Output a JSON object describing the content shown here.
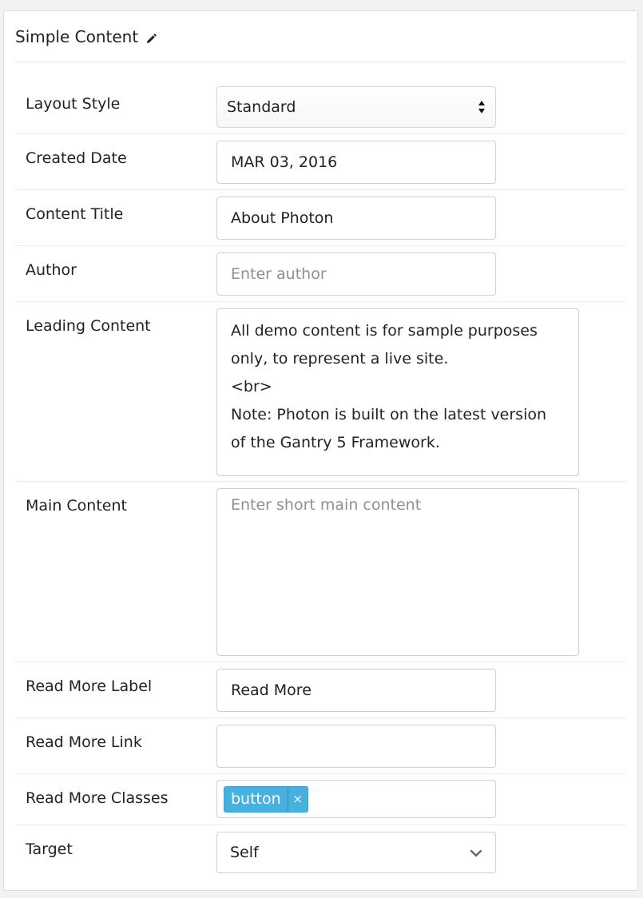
{
  "panel": {
    "title": "Simple Content",
    "title_icon": "pencil-icon"
  },
  "fields": {
    "layout_style": {
      "label": "Layout Style",
      "value": "Standard",
      "icon": "sort-updown-icon"
    },
    "created_date": {
      "label": "Created Date",
      "value": "MAR 03, 2016"
    },
    "content_title": {
      "label": "Content Title",
      "value": "About Photon"
    },
    "author": {
      "label": "Author",
      "value": "",
      "placeholder": "Enter author"
    },
    "leading_content": {
      "label": "Leading Content",
      "lines": [
        "All demo content is for sample purposes",
        "only, to represent a live site.",
        "<br>",
        "Note: Photon is built on the latest version",
        "of the Gantry 5 Framework."
      ]
    },
    "main_content": {
      "label": "Main Content",
      "value": "",
      "placeholder": "Enter short main content"
    },
    "read_more_label": {
      "label": "Read More Label",
      "value": "Read More"
    },
    "read_more_link": {
      "label": "Read More Link",
      "value": ""
    },
    "read_more_classes": {
      "label": "Read More Classes",
      "tags": [
        "button"
      ],
      "remove_glyph": "×"
    },
    "target": {
      "label": "Target",
      "value": "Self",
      "icon": "chevron-down-icon"
    }
  },
  "colors": {
    "tag_background": "#46b0de",
    "placeholder_text": "#8f8f8f",
    "border": "#cfcfcf"
  }
}
